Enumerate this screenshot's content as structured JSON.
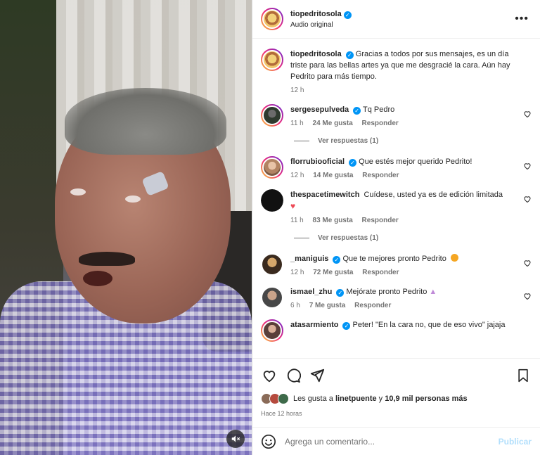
{
  "post": {
    "username": "tiopedritosola",
    "audio": "Audio original",
    "more_icon": "more-horizontal-icon"
  },
  "caption": {
    "username": "tiopedritosola",
    "text": "Gracias a todos por sus mensajes, es un día triste para las bellas artes ya que me desgracié la cara. Aún hay Pedrito para más tiempo.",
    "time": "12 h"
  },
  "comments": [
    {
      "username": "sergesepulveda",
      "verified": true,
      "text": "Tq Pedro",
      "time": "11 h",
      "likes": "24 Me gusta",
      "reply": "Responder",
      "view_replies": "Ver respuestas (1)"
    },
    {
      "username": "florrubiooficial",
      "verified": true,
      "text": "Que estés mejor querido Pedrito!",
      "time": "12 h",
      "likes": "14 Me gusta",
      "reply": "Responder"
    },
    {
      "username": "thespacetimewitch",
      "verified": false,
      "text": "Cuídese, usted ya es de edición limitada",
      "emoji": "heart",
      "time": "11 h",
      "likes": "83 Me gusta",
      "reply": "Responder",
      "view_replies": "Ver respuestas (1)"
    },
    {
      "username": "_maniguis",
      "verified": true,
      "text": "Que te mejores pronto Pedrito",
      "emoji": "kiss-face",
      "time": "12 h",
      "likes": "72 Me gusta",
      "reply": "Responder"
    },
    {
      "username": "ismael_zhu",
      "verified": true,
      "text": "Mejórate pronto Pedrito",
      "emoji": "praying-hands",
      "time": "6 h",
      "likes": "7 Me gusta",
      "reply": "Responder"
    },
    {
      "username": "atasarmiento",
      "verified": true,
      "text": "Peter! \"En la cara no, que de eso vivo\" jajaja"
    }
  ],
  "likes": {
    "prefix": "Les gusta a",
    "user": "linetpuente",
    "connector": "y",
    "others": "10,9 mil personas más"
  },
  "time_ago": "Hace 12 horas",
  "add_comment": {
    "placeholder": "Agrega un comentario...",
    "publish": "Publicar"
  },
  "colors": {
    "verified": "#0095f6",
    "heart": "#ed4956",
    "publish_disabled": "#b2dffc",
    "muted_text": "#737373"
  }
}
